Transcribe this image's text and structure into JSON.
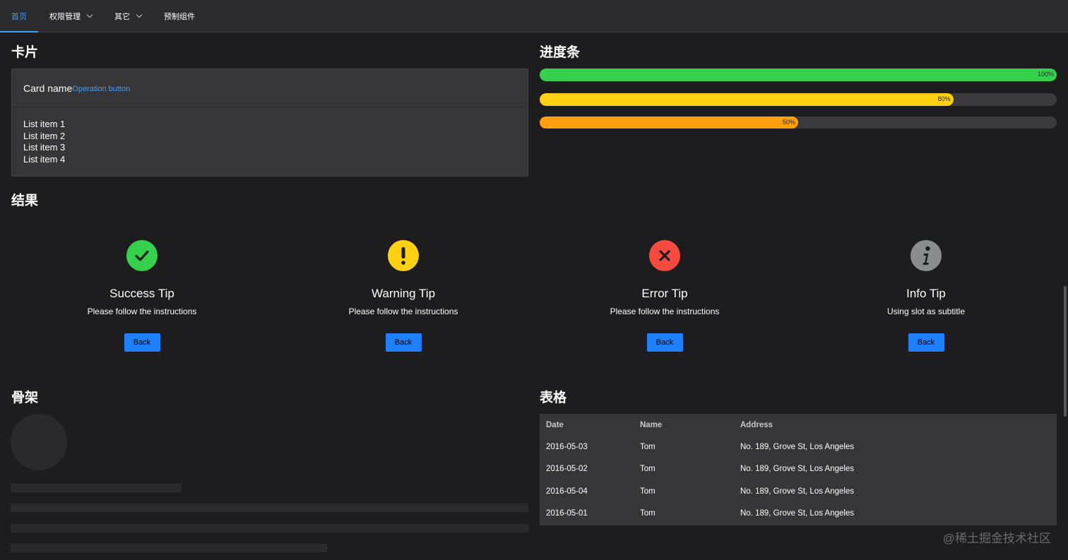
{
  "nav": {
    "items": [
      {
        "label": "首页",
        "active": true,
        "dropdown": false
      },
      {
        "label": "权限管理",
        "active": false,
        "dropdown": true
      },
      {
        "label": "其它",
        "active": false,
        "dropdown": true
      },
      {
        "label": "预制组件",
        "active": false,
        "dropdown": false
      }
    ]
  },
  "sections": {
    "card": "卡片",
    "progress": "进度条",
    "result": "结果",
    "skeleton": "骨架",
    "table": "表格"
  },
  "card": {
    "name": "Card name",
    "operation": "Operation button",
    "items": [
      "List item 1",
      "List item 2",
      "List item 3",
      "List item 4"
    ]
  },
  "progress": [
    {
      "label": "100%",
      "value": 100,
      "color": "#36d14c"
    },
    {
      "label": "80%",
      "value": 80,
      "color": "#ffd112"
    },
    {
      "label": "50%",
      "value": 50,
      "color": "#ff9f0e"
    }
  ],
  "results": [
    {
      "title": "Success Tip",
      "subtitle": "Please follow the instructions",
      "button": "Back",
      "icon": "check-icon",
      "color": "#36d14c"
    },
    {
      "title": "Warning Tip",
      "subtitle": "Please follow the instructions",
      "button": "Back",
      "icon": "exclamation-icon",
      "color": "#ffd112"
    },
    {
      "title": "Error Tip",
      "subtitle": "Please follow the instructions",
      "button": "Back",
      "icon": "close-icon",
      "color": "#f64a3f"
    },
    {
      "title": "Info Tip",
      "subtitle": "Using slot as subtitle",
      "button": "Back",
      "icon": "info-icon",
      "color": "#8b8c8f"
    }
  ],
  "table": {
    "headers": [
      "Date",
      "Name",
      "Address"
    ],
    "rows": [
      [
        "2016-05-03",
        "Tom",
        "No. 189, Grove St, Los Angeles"
      ],
      [
        "2016-05-02",
        "Tom",
        "No. 189, Grove St, Los Angeles"
      ],
      [
        "2016-05-04",
        "Tom",
        "No. 189, Grove St, Los Angeles"
      ],
      [
        "2016-05-01",
        "Tom",
        "No. 189, Grove St, Los Angeles"
      ]
    ]
  },
  "watermark": "@稀土掘金技术社区",
  "colors": {
    "accent": "#409eff",
    "button": "#1e80ff"
  }
}
